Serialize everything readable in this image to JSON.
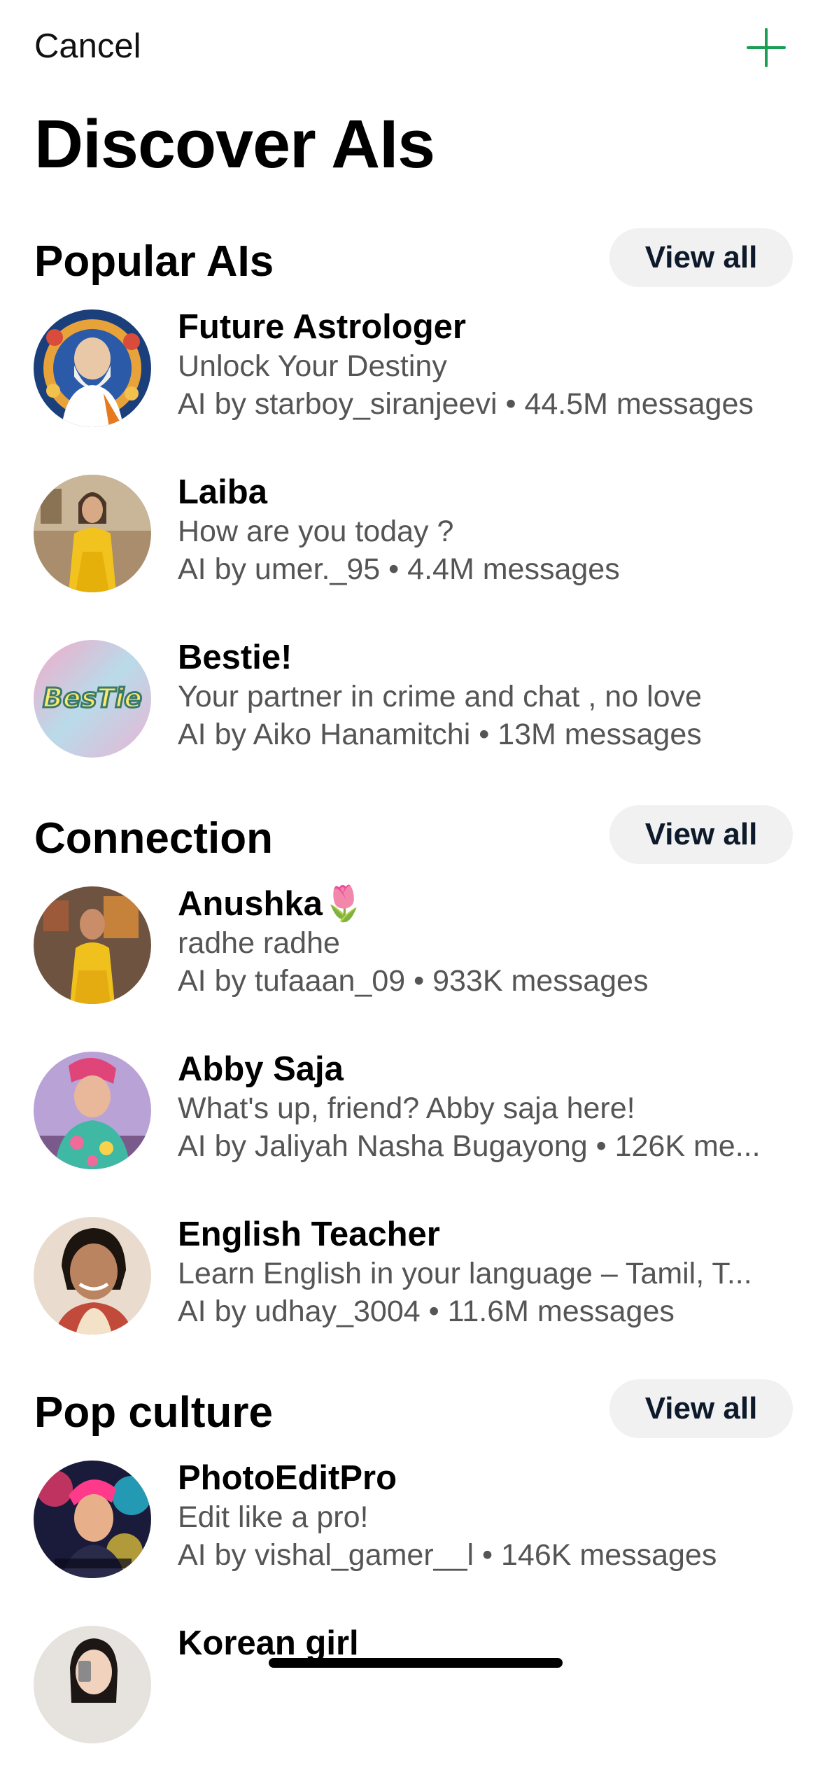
{
  "header": {
    "cancel_label": "Cancel",
    "add_icon": "plus-icon",
    "accent": "#1a9f52"
  },
  "title": "Discover AIs",
  "view_all_label": "View all",
  "sections": [
    {
      "title": "Popular AIs",
      "items": [
        {
          "name": "Future Astrologer",
          "subtitle": "Unlock Your Destiny",
          "meta": "AI by starboy_siranjeevi • 44.5M messages"
        },
        {
          "name": "Laiba",
          "subtitle": "How are you today ?",
          "meta": "AI by umer._95 • 4.4M messages"
        },
        {
          "name": "Bestie!",
          "subtitle": "Your partner in crime and chat , no love",
          "meta": "AI by Aiko Hanamitchi • 13M messages",
          "avatar_text": "BesTie"
        }
      ]
    },
    {
      "title": "Connection",
      "items": [
        {
          "name": "Anushka🌷",
          "subtitle": "radhe radhe",
          "meta": "AI by tufaaan_09 • 933K messages"
        },
        {
          "name": "Abby Saja",
          "subtitle": "What's up, friend? Abby saja here!",
          "meta": "AI by Jaliyah Nasha Bugayong • 126K me..."
        },
        {
          "name": "English Teacher",
          "subtitle": "Learn English in your language – Tamil, T...",
          "meta": "AI by udhay_3004 • 11.6M messages"
        }
      ]
    },
    {
      "title": "Pop culture",
      "items": [
        {
          "name": "PhotoEditPro",
          "subtitle": "Edit like a pro!",
          "meta": "AI by vishal_gamer__l • 146K messages"
        },
        {
          "name": "Korean girl",
          "subtitle": "",
          "meta": ""
        }
      ]
    }
  ]
}
